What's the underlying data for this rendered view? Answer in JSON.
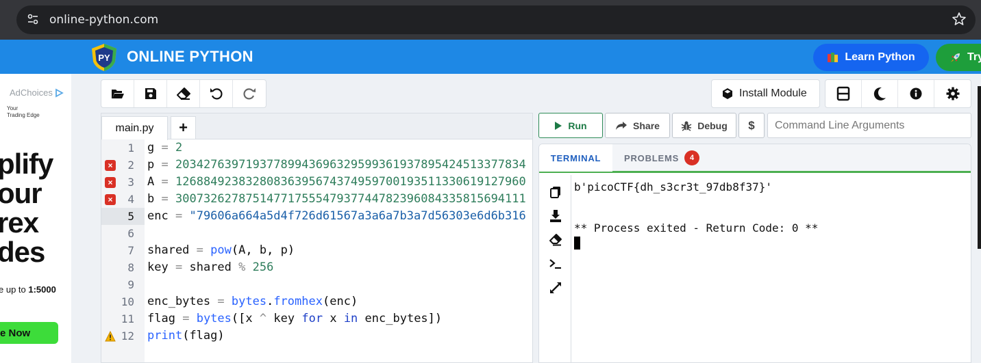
{
  "browser": {
    "url": "online-python.com"
  },
  "header": {
    "brand": "ONLINE PYTHON",
    "logo_text": "PY",
    "learn_label": "Learn Python",
    "try_label": "Try"
  },
  "ad": {
    "adchoices": "AdChoices",
    "small_text": [
      "Your",
      "Trading Edge"
    ],
    "headline": [
      "plify",
      "our",
      "rex",
      "des"
    ],
    "leverage": "e up to ",
    "leverage_bold": "1:5000",
    "cta": "e Now"
  },
  "toolbar": {
    "icons": [
      "folder-open-icon",
      "save-icon",
      "eraser-icon",
      "undo-icon",
      "redo-icon"
    ],
    "install_label": "Install Module",
    "right_icons": [
      "layout-icon",
      "moon-icon",
      "info-icon",
      "gear-icon"
    ]
  },
  "editor": {
    "tab_label": "main.py",
    "add_tab_label": "+",
    "active_line": 5,
    "lines": [
      {
        "n": "1",
        "marker": "",
        "text": "g = 2"
      },
      {
        "n": "2",
        "marker": "error",
        "text": "p = 20342763971937789943696329599361937895424513377834"
      },
      {
        "n": "3",
        "marker": "error",
        "text": "A = 12688492383280836395674374959700193511330619127960"
      },
      {
        "n": "4",
        "marker": "error",
        "text": "b = 30073262787514771755547937744782396084335815694111"
      },
      {
        "n": "5",
        "marker": "",
        "text": "enc = \"79606a664a5d4f726d61567a3a6a7b3a7d56303e6d6b316"
      },
      {
        "n": "6",
        "marker": "",
        "text": ""
      },
      {
        "n": "7",
        "marker": "",
        "text": "shared = pow(A, b, p)"
      },
      {
        "n": "8",
        "marker": "",
        "text": "key = shared % 256"
      },
      {
        "n": "9",
        "marker": "",
        "text": ""
      },
      {
        "n": "10",
        "marker": "",
        "text": "enc_bytes = bytes.fromhex(enc)"
      },
      {
        "n": "11",
        "marker": "",
        "text": "flag = bytes([x ^ key for x in enc_bytes])"
      },
      {
        "n": "12",
        "marker": "warning",
        "text": "print(flag)"
      }
    ]
  },
  "runbar": {
    "run_label": "Run",
    "share_label": "Share",
    "debug_label": "Debug",
    "dollar_label": "$",
    "args_placeholder": "Command Line Arguments"
  },
  "terminal": {
    "tab_terminal": "TERMINAL",
    "tab_problems": "PROBLEMS",
    "problems_count": "4",
    "side_icons": [
      "copy-icon",
      "download-icon",
      "clear-icon",
      "prompt-icon",
      "expand-icon"
    ],
    "output": [
      "b'picoCTF{dh_s3cr3t_97db8f37}'",
      "",
      "** Process exited - Return Code: 0 **"
    ]
  },
  "colors": {
    "header": "#1e88e5",
    "run": "#1d7a46",
    "error": "#d93025",
    "accent_line": "#4caf50"
  }
}
